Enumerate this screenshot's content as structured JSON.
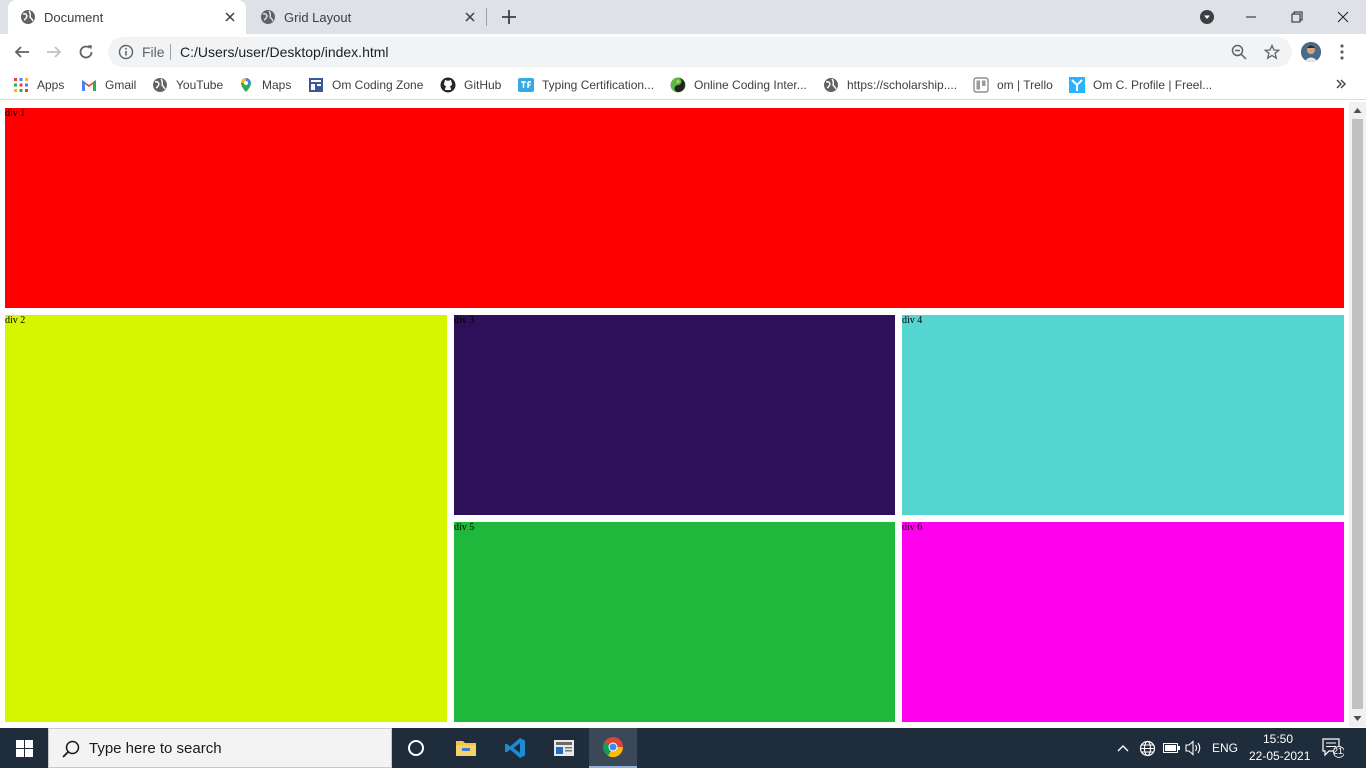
{
  "browser": {
    "tabs": [
      {
        "title": "Document",
        "active": true
      },
      {
        "title": "Grid Layout",
        "active": false
      }
    ],
    "address": {
      "scheme": "File",
      "url": "C:/Users/user/Desktop/index.html"
    },
    "bookmarks": [
      {
        "label": "Apps",
        "icon": "apps-grid-icon"
      },
      {
        "label": "Gmail",
        "icon": "gmail-icon"
      },
      {
        "label": "YouTube",
        "icon": "globe-icon"
      },
      {
        "label": "Maps",
        "icon": "maps-pin-icon"
      },
      {
        "label": "Om Coding Zone",
        "icon": "blog-icon"
      },
      {
        "label": "GitHub",
        "icon": "github-icon"
      },
      {
        "label": "Typing Certification...",
        "icon": "typing-icon"
      },
      {
        "label": "Online Coding Inter...",
        "icon": "coding-icon"
      },
      {
        "label": "https://scholarship....",
        "icon": "globe-icon"
      },
      {
        "label": "om | Trello",
        "icon": "trello-icon"
      },
      {
        "label": "Om C. Profile | Freel...",
        "icon": "freelancer-icon"
      }
    ]
  },
  "page": {
    "boxes": [
      {
        "label": "div 1",
        "color": "#ff0000"
      },
      {
        "label": "div 2",
        "color": "#d4f700"
      },
      {
        "label": "div 3",
        "color": "#2e0f5a"
      },
      {
        "label": "div 4",
        "color": "#55d5d1"
      },
      {
        "label": "div 5",
        "color": "#1fb83d"
      },
      {
        "label": "div 6",
        "color": "#ff00ee"
      }
    ]
  },
  "taskbar": {
    "search_placeholder": "Type here to search",
    "language": "ENG",
    "time": "15:50",
    "date": "22-05-2021",
    "notification_count": "21"
  }
}
